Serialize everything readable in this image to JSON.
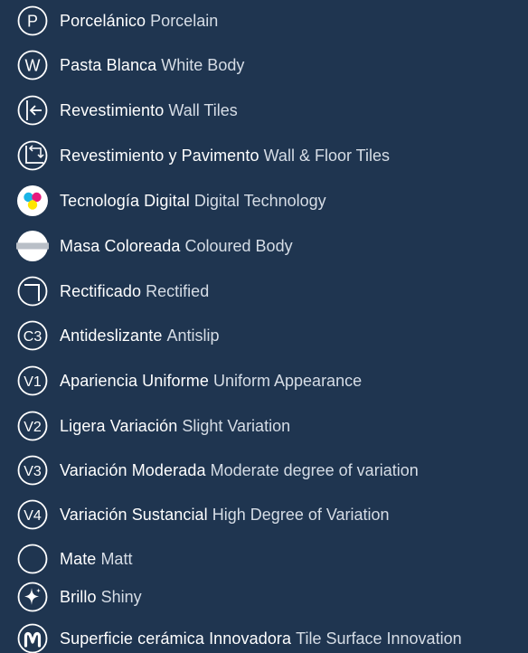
{
  "rows": [
    {
      "icon": "porcelain-p-icon",
      "code": "P",
      "es": "Porcelánico",
      "en": "Porcelain"
    },
    {
      "icon": "white-body-w-icon",
      "code": "W",
      "es": "Pasta Blanca",
      "en": "White Body"
    },
    {
      "icon": "wall-tiles-icon",
      "code": "",
      "es": "Revestimiento",
      "en": "Wall Tiles"
    },
    {
      "icon": "wall-floor-tiles-icon",
      "code": "",
      "es": "Revestimiento y Pavimento",
      "en": "Wall & Floor Tiles"
    },
    {
      "icon": "digital-technology-icon",
      "code": "",
      "es": "Tecnología Digital",
      "en": "Digital Technology"
    },
    {
      "icon": "coloured-body-icon",
      "code": "",
      "es": "Masa Coloreada",
      "en": "Coloured Body"
    },
    {
      "icon": "rectified-icon",
      "code": "",
      "es": "Rectificado",
      "en": "Rectified"
    },
    {
      "icon": "antislip-c3-icon",
      "code": "C3",
      "es": "Antideslizante",
      "en": "Antislip"
    },
    {
      "icon": "uniform-v1-icon",
      "code": "V1",
      "es": "Apariencia Uniforme",
      "en": "Uniform Appearance"
    },
    {
      "icon": "slight-variation-v2-icon",
      "code": "V2",
      "es": "Ligera Variación",
      "en": "Slight Variation"
    },
    {
      "icon": "moderate-variation-v3-icon",
      "code": "V3",
      "es": "Variación Moderada",
      "en": "Moderate degree of variation"
    },
    {
      "icon": "high-variation-v4-icon",
      "code": "V4",
      "es": "Variación Sustancial",
      "en": "High Degree of Variation"
    },
    {
      "icon": "matt-circle-icon",
      "code": "",
      "es": "Mate",
      "en": "Matt"
    },
    {
      "icon": "shiny-sparkle-icon",
      "code": "",
      "es": "Brillo",
      "en": "Shiny"
    },
    {
      "icon": "innovation-m-icon",
      "code": "",
      "es": "Superficie cerámica Innovadora",
      "en": "Tile Surface Innovation"
    }
  ],
  "colors": {
    "background": "#1f3550",
    "text": "#ffffff",
    "cyan": "#19b4e6",
    "magenta": "#e6197d",
    "yellow": "#ffe600"
  }
}
